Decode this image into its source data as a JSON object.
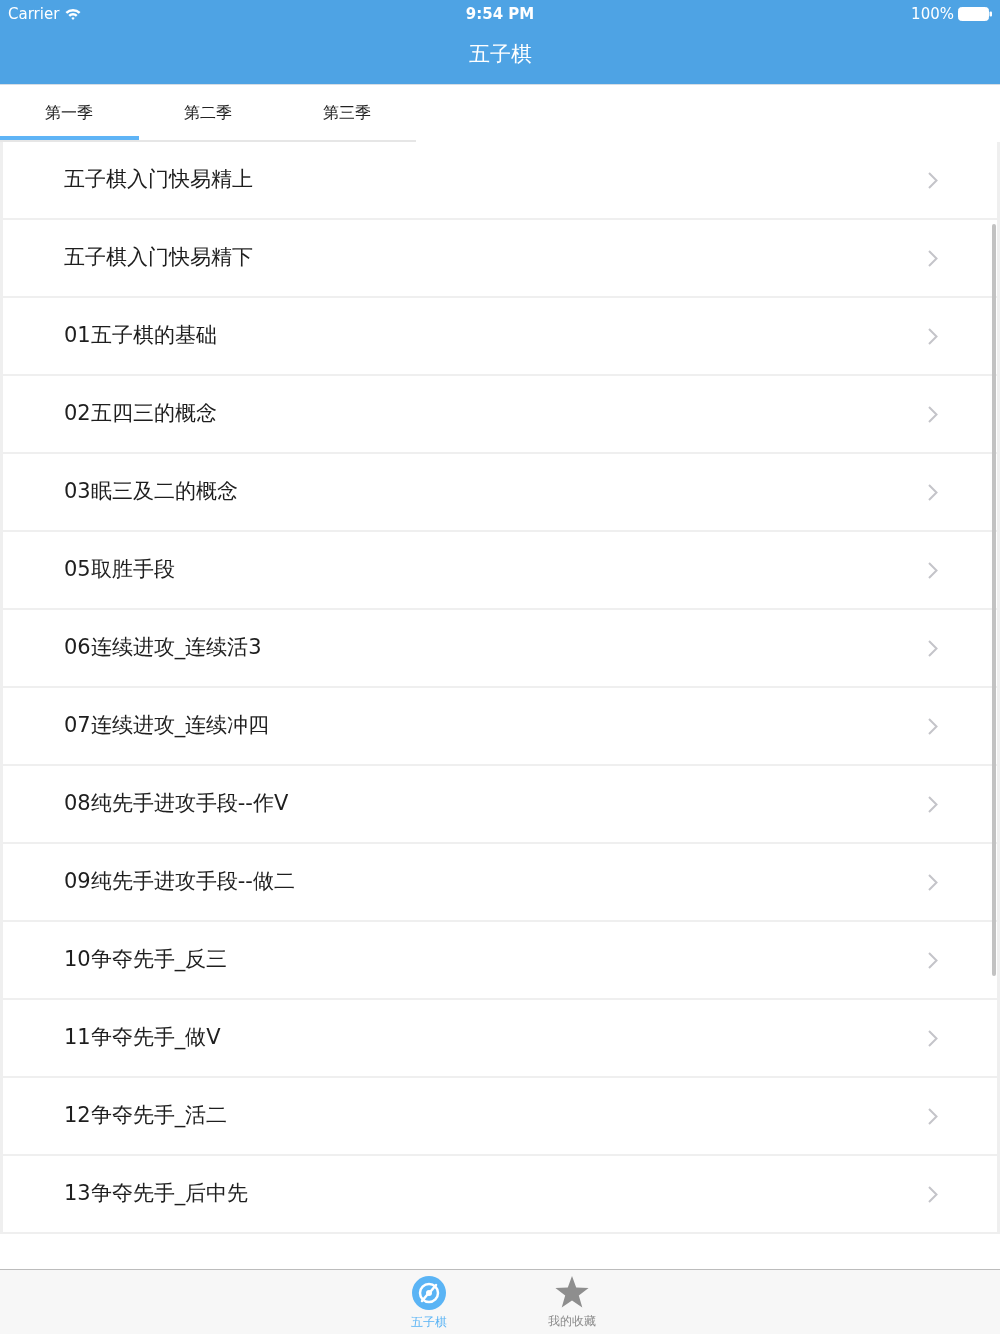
{
  "status_bar": {
    "carrier": "Carrier",
    "time": "9:54 PM",
    "battery": "100%"
  },
  "nav_bar": {
    "title": "五子棋"
  },
  "tabs": [
    {
      "label": "第一季",
      "selected": true
    },
    {
      "label": "第二季",
      "selected": false
    },
    {
      "label": "第三季",
      "selected": false
    }
  ],
  "list": {
    "items": [
      {
        "title": "五子棋入门快易精上"
      },
      {
        "title": "五子棋入门快易精下"
      },
      {
        "title": "01五子棋的基础"
      },
      {
        "title": "02五四三的概念"
      },
      {
        "title": "03眠三及二的概念"
      },
      {
        "title": "05取胜手段"
      },
      {
        "title": "06连续进攻_连续活3"
      },
      {
        "title": "07连续进攻_连续冲四"
      },
      {
        "title": "08纯先手进攻手段--作V"
      },
      {
        "title": "09纯先手进攻手段--做二"
      },
      {
        "title": "10争夺先手_反三"
      },
      {
        "title": "11争夺先手_做V"
      },
      {
        "title": "12争夺先手_活二"
      },
      {
        "title": "13争夺先手_后中先"
      }
    ]
  },
  "tab_bar": [
    {
      "label": "五子棋",
      "kind": "disc",
      "selected": true
    },
    {
      "label": "我的收藏",
      "kind": "star",
      "selected": false
    }
  ]
}
